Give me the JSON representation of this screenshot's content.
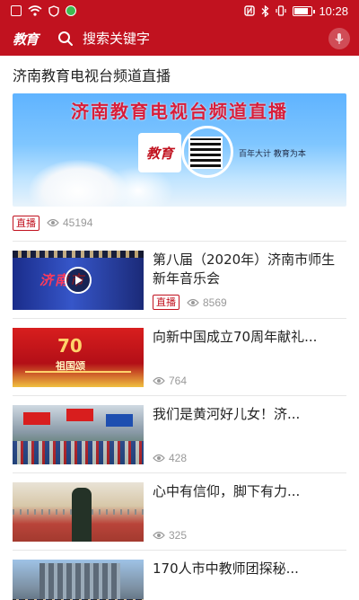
{
  "statusbar": {
    "time": "10:28",
    "battery_level": 0.85
  },
  "header": {
    "logo_text": "教育",
    "search_placeholder": "搜索关键字"
  },
  "section": {
    "title": "济南教育电视台频道直播"
  },
  "featured": {
    "banner_title": "济南教育电视台频道直播",
    "logo_text": "教育",
    "slogan": "百年大计  教育为本",
    "badge": "直播",
    "views": "45194"
  },
  "items": [
    {
      "title": "第八届（2020年）济南市师生新年音乐会",
      "badge": "直播",
      "views": "8569",
      "thumb_text": "济南市"
    },
    {
      "title": "向新中国成立70周年献礼...",
      "badge": "",
      "views": "764",
      "thumb_num": "70",
      "thumb_text": "祖国颂"
    },
    {
      "title": "我们是黄河好儿女！济...",
      "badge": "",
      "views": "428"
    },
    {
      "title": "心中有信仰，脚下有力...",
      "badge": "",
      "views": "325"
    },
    {
      "title": "170人市中教师团探秘...",
      "badge": "",
      "views": ""
    }
  ]
}
